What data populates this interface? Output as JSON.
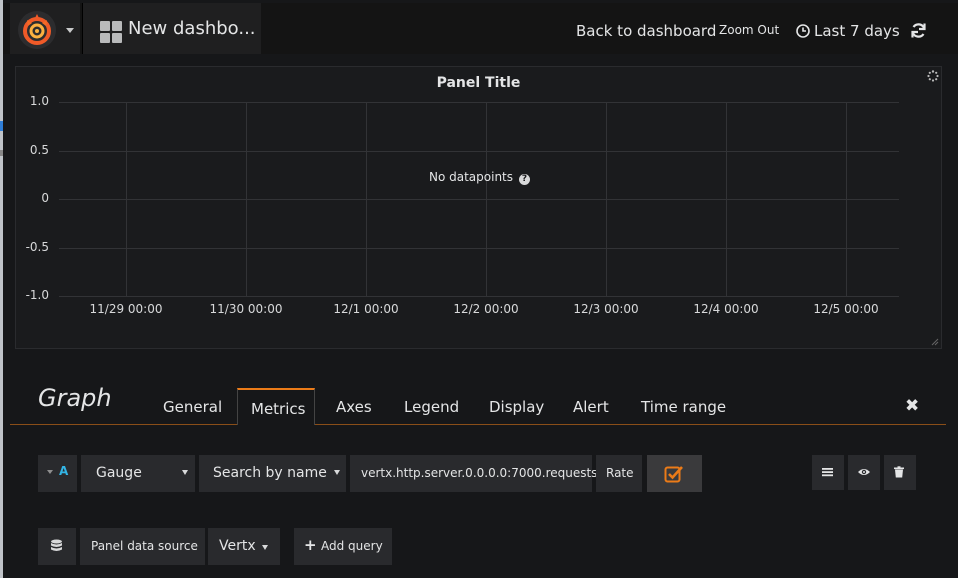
{
  "navbar": {
    "dashboard_title": "New dashbo...",
    "back_to_dashboard": "Back to dashboard",
    "zoom_out": "Zoom Out",
    "time_range": "Last 7 days"
  },
  "panel": {
    "title": "Panel Title",
    "no_data": "No datapoints",
    "help_glyph": "?"
  },
  "chart_data": {
    "type": "line",
    "title": "Panel Title",
    "x": [
      "11/29 00:00",
      "11/30 00:00",
      "12/1 00:00",
      "12/2 00:00",
      "12/3 00:00",
      "12/4 00:00",
      "12/5 00:00"
    ],
    "y_ticks": [
      "1.0",
      "0.5",
      "0",
      "-0.5",
      "-1.0"
    ],
    "ylim": [
      -1.0,
      1.0
    ],
    "series": [],
    "grid": true,
    "annotation": "No datapoints"
  },
  "editor": {
    "title": "Graph",
    "tabs": [
      "General",
      "Metrics",
      "Axes",
      "Legend",
      "Display",
      "Alert",
      "Time range"
    ],
    "active_tab": "Metrics",
    "close_glyph": "✖"
  },
  "query": {
    "ref_id": "A",
    "metric_type": "Gauge",
    "search_mode": "Search by name",
    "metric_name": "vertx.http.server.0.0.0.0:7000.requests",
    "rate_label": "Rate",
    "rate_checked": true
  },
  "datasource": {
    "label": "Panel data source",
    "selected": "Vertx",
    "add_query": "Add query",
    "add_glyph": "+"
  },
  "colors": {
    "accent": "#eb7b18",
    "ref_id": "#33b5e5",
    "background": "#161719",
    "panel": "#1a1b1d"
  },
  "icons": [
    "grafana-logo-icon",
    "dashboard-grid-icon",
    "clock-icon",
    "refresh-icon",
    "spinner-icon",
    "question-circle-icon",
    "close-icon",
    "hamburger-icon",
    "eye-icon",
    "trash-icon",
    "database-icon",
    "plus-icon",
    "check-square-icon"
  ]
}
